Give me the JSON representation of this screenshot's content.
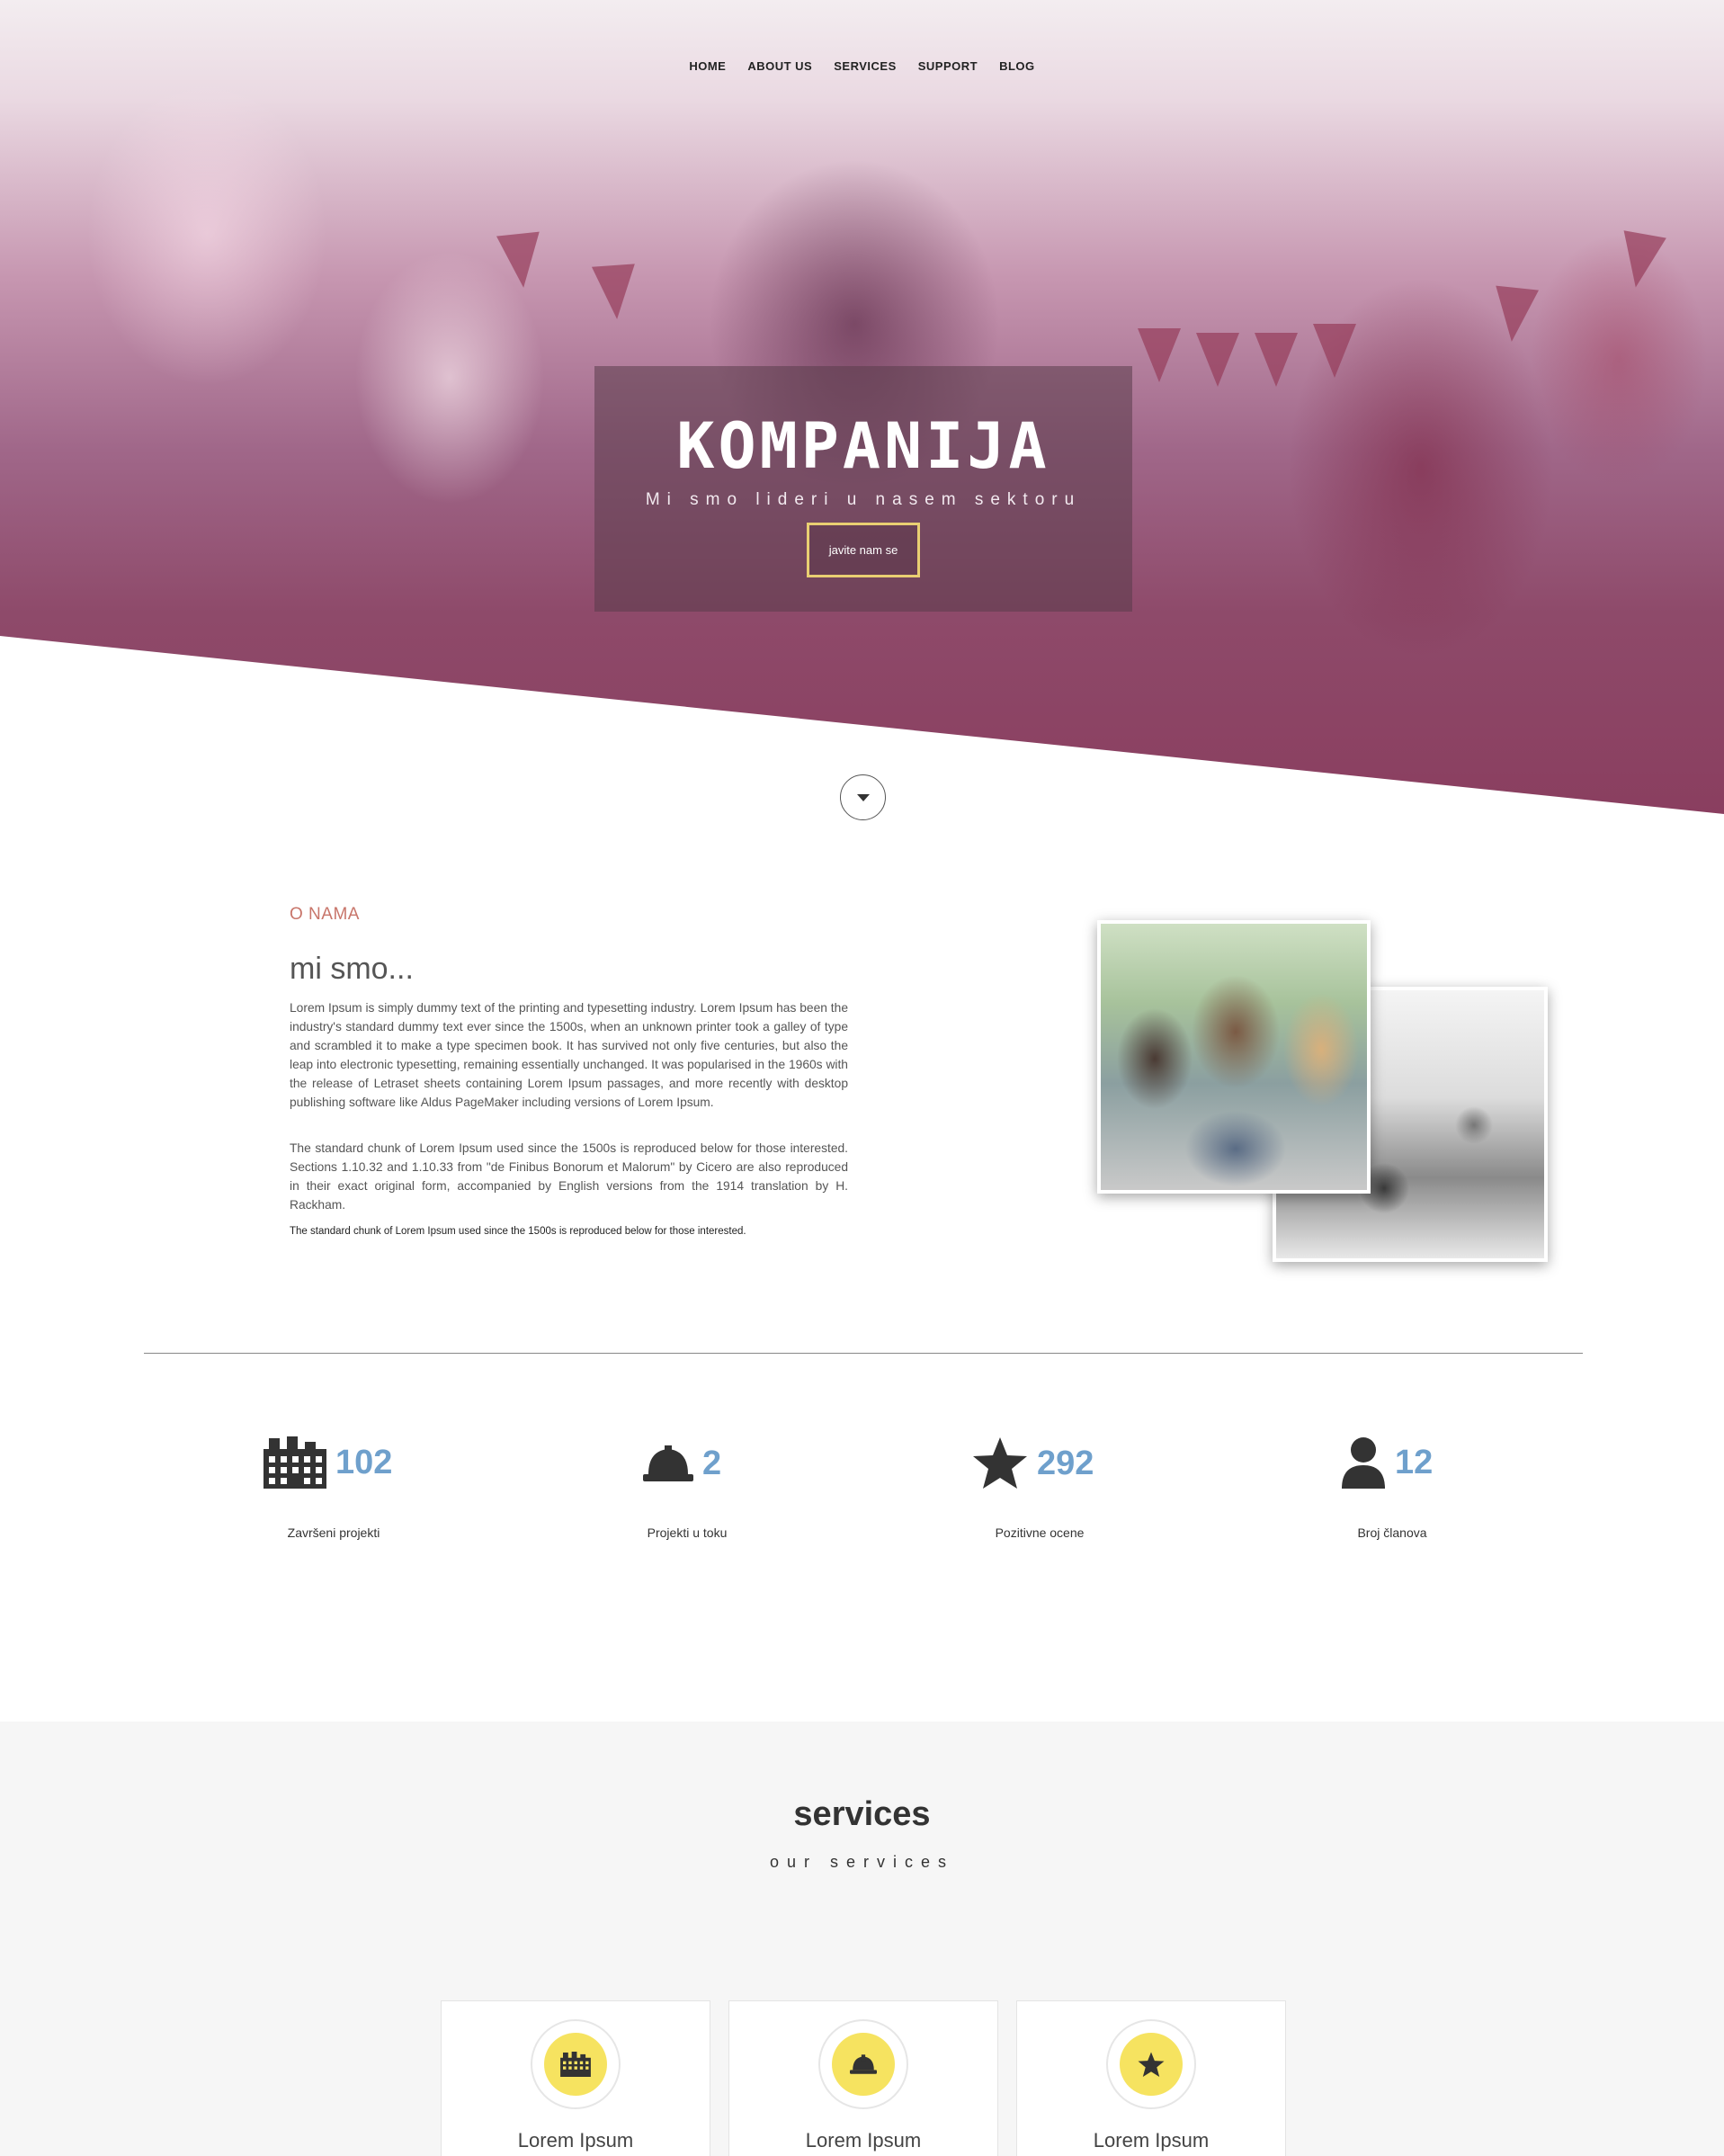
{
  "nav": {
    "items": [
      {
        "label": "HOME"
      },
      {
        "label": "ABOUT US"
      },
      {
        "label": "SERVICES"
      },
      {
        "label": "SUPPORT"
      },
      {
        "label": "BLOG"
      }
    ]
  },
  "hero": {
    "title": "KOMPANIJA",
    "subtitle": "Mi smo lideri u nasem sektoru",
    "button_label": "javite nam se",
    "accent_color": "#e9cf72"
  },
  "about": {
    "kicker": "O NAMA",
    "title": "mi smo...",
    "paragraph1": "Lorem Ipsum is simply dummy text of the printing and typesetting industry. Lorem Ipsum has been the industry's standard dummy text ever since the 1500s, when an unknown printer took a galley of type and scrambled it to make a type specimen book. It has survived not only five centuries, but also the leap into electronic typesetting, remaining essentially unchanged. It was popularised in the 1960s with the release of Letraset sheets containing Lorem Ipsum passages, and more recently with desktop publishing software like Aldus PageMaker including versions of Lorem Ipsum.",
    "paragraph2": "The standard chunk of Lorem Ipsum used since the 1500s is reproduced below for those interested. Sections 1.10.32 and 1.10.33 from \"de Finibus Bonorum et Malorum\" by Cicero are also reproduced in their exact original form, accompanied by English versions from the 1914 translation by H. Rackham.",
    "small_note": "The standard chunk of Lorem Ipsum used since the 1500s is reproduced below for those interested.",
    "kicker_color": "#c8756a"
  },
  "stats": [
    {
      "icon": "building-icon",
      "value": "102",
      "label": "Završeni projekti"
    },
    {
      "icon": "hard-hat-icon",
      "value": "2",
      "label": "Projekti u toku"
    },
    {
      "icon": "star-icon",
      "value": "292",
      "label": "Pozitivne ocene"
    },
    {
      "icon": "user-icon",
      "value": "12",
      "label": "Broj članova"
    }
  ],
  "stats_color": "#6fa0cc",
  "services": {
    "title": "services",
    "subtitle": "our services",
    "cards": [
      {
        "icon": "building-icon",
        "label": "Lorem Ipsum"
      },
      {
        "icon": "hard-hat-icon",
        "label": "Lorem Ipsum"
      },
      {
        "icon": "star-icon",
        "label": "Lorem Ipsum"
      }
    ],
    "icon_bg_color": "#f6e360"
  }
}
